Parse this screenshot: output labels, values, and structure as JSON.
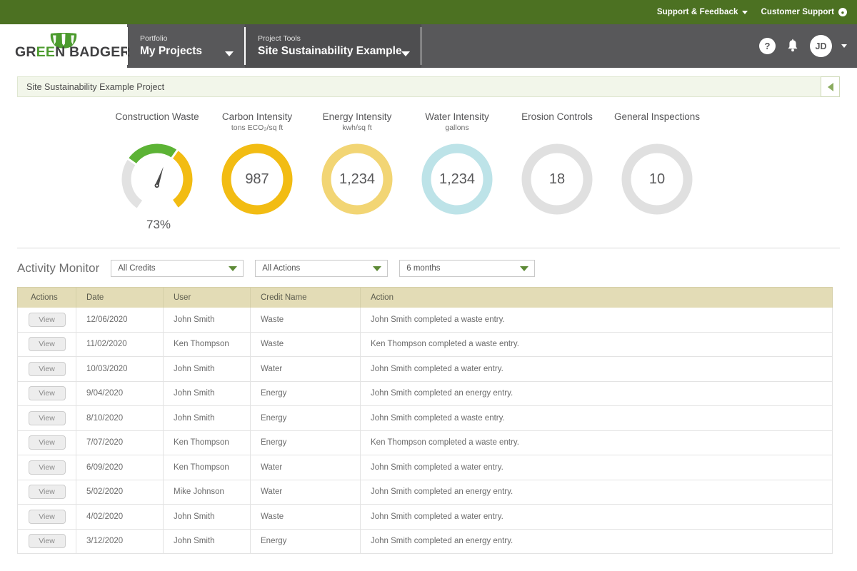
{
  "topbar": {
    "support_feedback": "Support & Feedback",
    "customer_support": "Customer Support"
  },
  "brand": {
    "name_part1": "GR",
    "name_green": "EE",
    "name_part2": "N BADGER",
    "green": "#4c9b2e",
    "bar_green": "#4c7122"
  },
  "nav": {
    "portfolio_label": "Portfolio",
    "portfolio_value": "My Projects",
    "project_tools_label": "Project Tools",
    "project_tools_value": "Site Sustainability Example",
    "help_icon": "?",
    "avatar_initials": "JD"
  },
  "banner": {
    "project_name": "Site Sustainability Example Project"
  },
  "gauges": [
    {
      "title": "Construction Waste",
      "subtitle": "",
      "value": "",
      "percent_label": "73%",
      "percent": 73,
      "type": "needle",
      "colors": {
        "green": "#5cb335",
        "yellow": "#f2bc13",
        "grey": "#e2e2e2"
      }
    },
    {
      "title": "Carbon Intensity",
      "subtitle": "tons ECO₂/sq ft",
      "value": "987",
      "percent_label": "",
      "type": "ring",
      "color": "#f2bc13"
    },
    {
      "title": "Energy Intensity",
      "subtitle": "kwh/sq ft",
      "value": "1,234",
      "percent_label": "",
      "type": "ring",
      "color": "#f2d574"
    },
    {
      "title": "Water Intensity",
      "subtitle": "gallons",
      "value": "1,234",
      "percent_label": "",
      "type": "ring",
      "color": "#bde3e8"
    },
    {
      "title": "Erosion Controls",
      "subtitle": "",
      "value": "18",
      "percent_label": "",
      "type": "ring",
      "color": "#e0e0e0"
    },
    {
      "title": "General Inspections",
      "subtitle": "",
      "value": "10",
      "percent_label": "",
      "type": "ring",
      "color": "#e0e0e0"
    }
  ],
  "activity": {
    "title": "Activity Monitor",
    "filters": [
      {
        "value": "All Credits"
      },
      {
        "value": "All Actions"
      },
      {
        "value": "6 months"
      }
    ],
    "columns": [
      "Actions",
      "Date",
      "User",
      "Credit Name",
      "Action"
    ],
    "view_label": "View",
    "rows": [
      {
        "date": "12/06/2020",
        "user": "John Smith",
        "credit": "Waste",
        "action": "John Smith completed a waste entry."
      },
      {
        "date": "11/02/2020",
        "user": "Ken Thompson",
        "credit": "Waste",
        "action": "Ken Thompson completed a waste entry."
      },
      {
        "date": "10/03/2020",
        "user": "John Smith",
        "credit": "Water",
        "action": "John Smith completed a water entry."
      },
      {
        "date": "9/04/2020",
        "user": "John Smith",
        "credit": "Energy",
        "action": "John Smith completed an energy entry."
      },
      {
        "date": "8/10/2020",
        "user": "John Smith",
        "credit": "Energy",
        "action": "John Smith completed a waste entry."
      },
      {
        "date": "7/07/2020",
        "user": "Ken Thompson",
        "credit": "Energy",
        "action": "Ken Thompson completed a waste entry."
      },
      {
        "date": "6/09/2020",
        "user": "Ken Thompson",
        "credit": "Water",
        "action": "John Smith completed a water entry."
      },
      {
        "date": "5/02/2020",
        "user": "Mike Johnson",
        "credit": "Water",
        "action": "John Smith completed an energy entry."
      },
      {
        "date": "4/02/2020",
        "user": "John Smith",
        "credit": "Waste",
        "action": "John Smith completed a water entry."
      },
      {
        "date": "3/12/2020",
        "user": "John Smith",
        "credit": "Energy",
        "action": "John Smith completed an energy entry."
      }
    ]
  }
}
